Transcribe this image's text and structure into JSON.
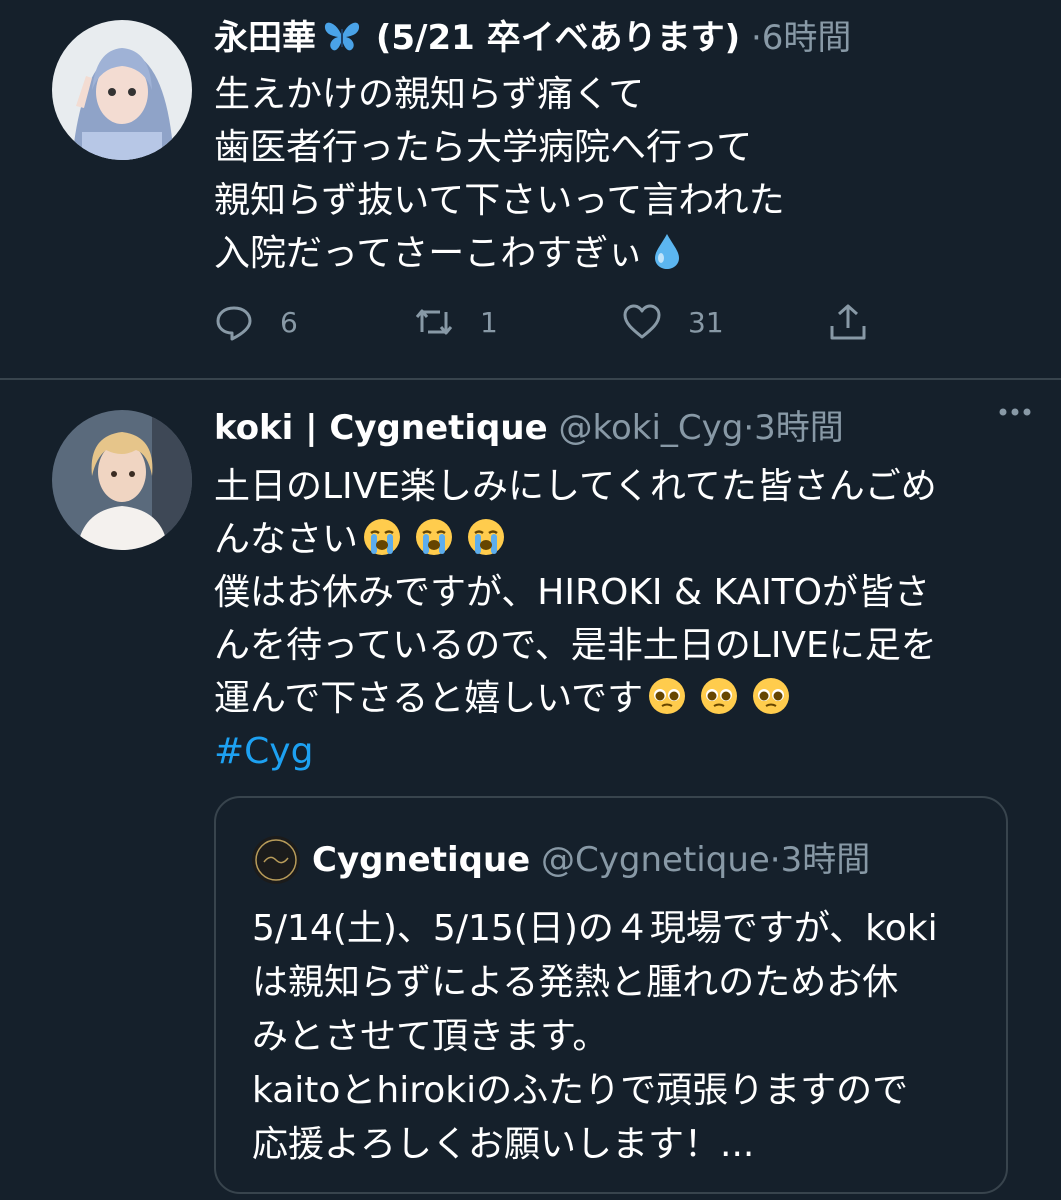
{
  "tweets": [
    {
      "author_name": "永田華",
      "author_name_suffix": " (5/21 卒イベあります)",
      "separator": "·",
      "time": "6時間",
      "lines": [
        "生えかけの親知らず痛くて",
        "歯医者行ったら大学病院へ行って",
        "親知らず抜いて下さいって言われた",
        "入院だってさーこわすぎぃ"
      ],
      "name_emoji": "butterfly-icon",
      "text_emoji": "droplet-icon",
      "actions": {
        "reply_count": "6",
        "retweet_count": "1",
        "like_count": "31"
      }
    },
    {
      "author_name": "koki | Cygnetique",
      "handle": "@koki_Cyg",
      "separator": "·",
      "time": "3時間",
      "lines": [
        "土日のLIVE楽しみにしてくれてた皆さんごめ",
        "んなさい",
        "僕はお休みですが、HIROKI & KAITOが皆さ",
        "んを待っているので、是非土日のLIVEに足を",
        "運んで下さると嬉しいです"
      ],
      "hashtag": "#Cyg",
      "emojis": [
        "loudly-crying-face-icon",
        "pleading-face-icon"
      ],
      "quote": {
        "author_name": "Cygnetique",
        "handle": "@Cygnetique",
        "separator": "·",
        "time": "3時間",
        "lines": [
          "5/14(土)、5/15(日)の４現場ですが、koki",
          "は親知らずによる発熱と腫れのためお休",
          "みとさせて頂きます。",
          "kaitoとhirokiのふたりで頑張りますので",
          "応援よろしくお願いします！..."
        ]
      }
    }
  ],
  "colors": {
    "background": "#15202b",
    "divider": "#38444d",
    "secondary_text": "#8899a6",
    "link": "#1da1f2"
  }
}
